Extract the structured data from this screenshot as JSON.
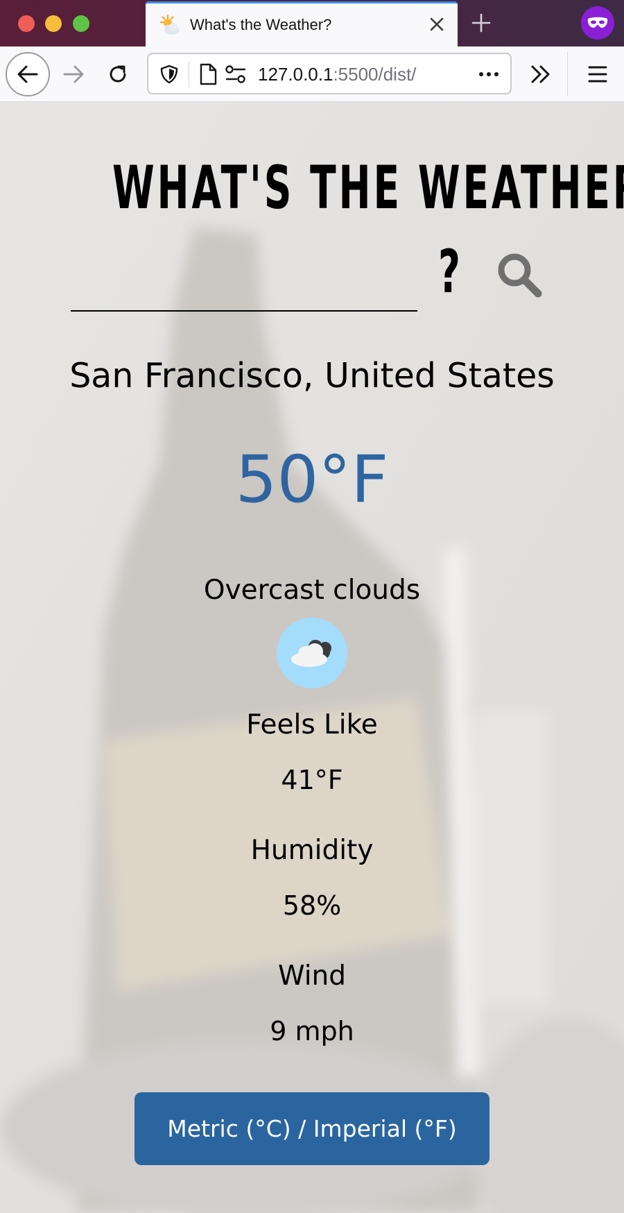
{
  "browser": {
    "tab_title": "What's the Weather?",
    "url_host": "127.0.0.1",
    "url_rest": ":5500/dist/",
    "accent_color": "#3b8ef0",
    "private_color": "#8a1fd6"
  },
  "page": {
    "heading": "WHAT'S THE WEATHER IN",
    "search_value": "",
    "question_mark": "?",
    "location": "San Francisco, United States",
    "temperature": "50°F",
    "description": "Overcast clouds",
    "weather_icon": "overcast-clouds-icon",
    "stats": [
      {
        "label": "Feels Like",
        "value": "41°F"
      },
      {
        "label": "Humidity",
        "value": "58%"
      },
      {
        "label": "Wind",
        "value": "9 mph"
      }
    ],
    "unit_toggle_label": "Metric (°C) / Imperial (°F)",
    "accent_color": "#2a65a0"
  }
}
